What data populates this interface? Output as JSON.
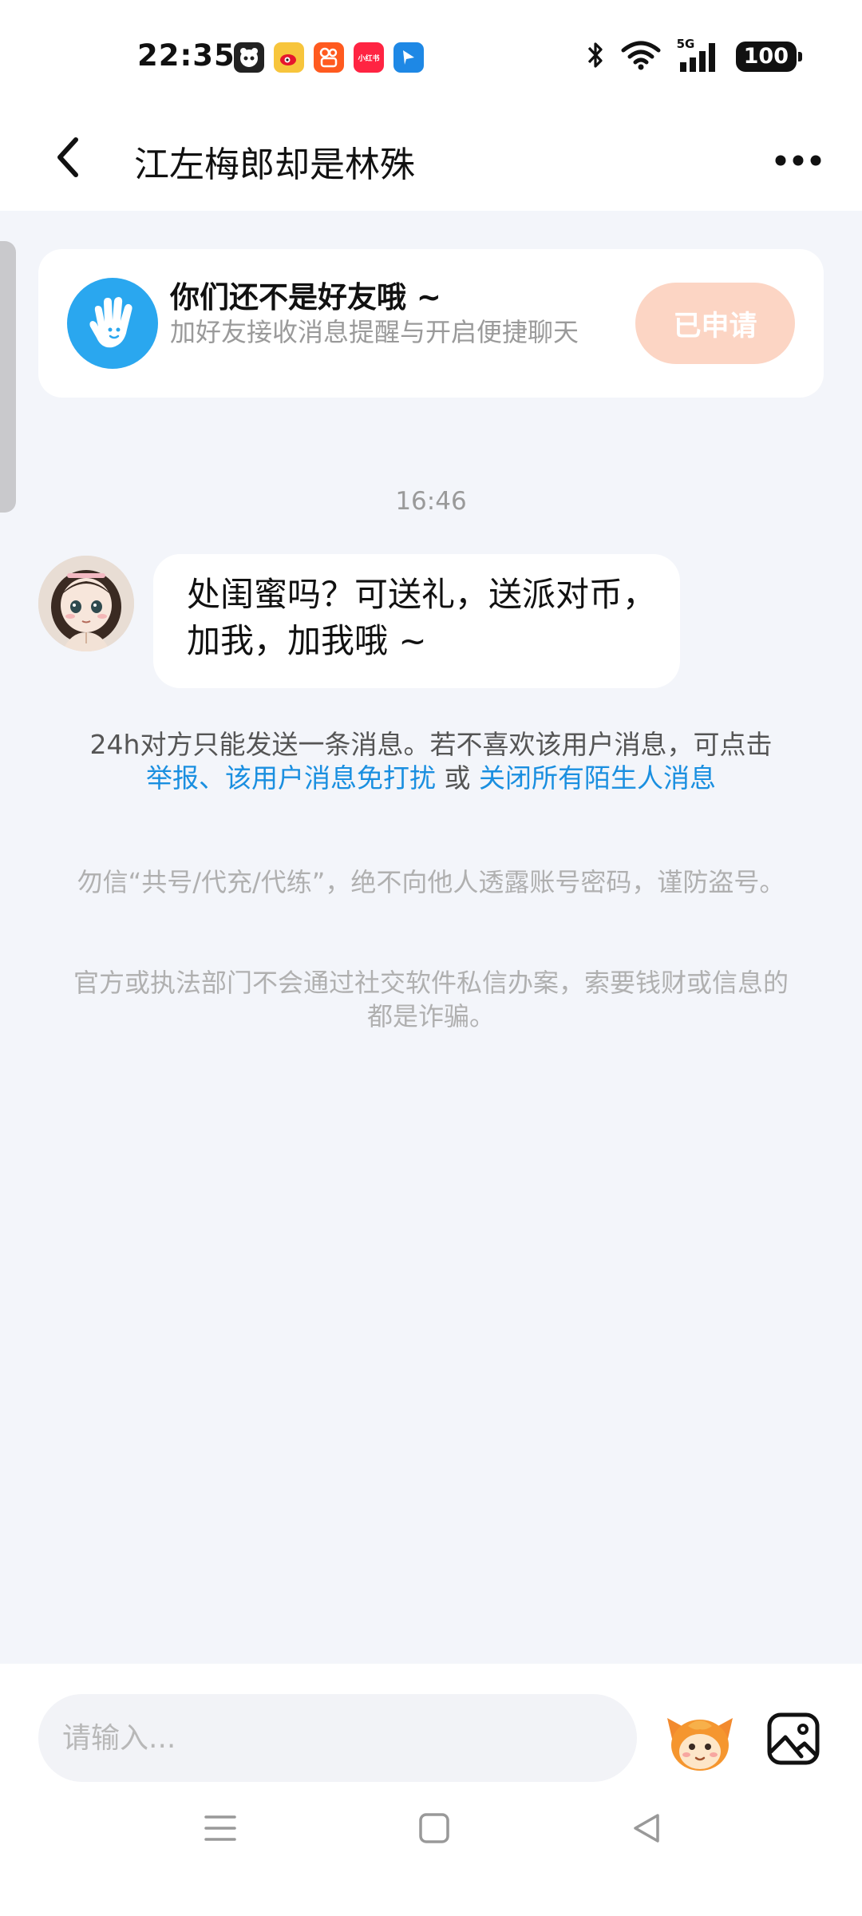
{
  "status_bar": {
    "time": "22:35",
    "network": "5G",
    "battery": "100",
    "app_icons": [
      "panda-app-icon",
      "weibo-icon",
      "kuaishou-icon",
      "xiaohongshu-icon",
      "feishu-icon"
    ],
    "xiaohongshu_label": "小红书"
  },
  "header": {
    "title": "江左梅郎却是林殊"
  },
  "friend_card": {
    "title": "你们还不是好友哦 ~",
    "subtitle": "加好友接收消息提醒与开启便捷聊天",
    "button_label": "已申请"
  },
  "chat": {
    "timestamp": "16:46",
    "message": "处闺蜜吗？可送礼，送派对币，加我，加我哦 ~"
  },
  "notice": {
    "text": "24h对方只能发送一条消息。若不喜欢该用户消息，可点击",
    "link_report": "举报",
    "link_mute": "、该用户消息免打扰",
    "or": " 或 ",
    "link_close_all": "关闭所有陌生人消息"
  },
  "warnings": {
    "warning1": "勿信“共号/代充/代练”，绝不向他人透露账号密码，谨防盗号。",
    "warning2": "官方或执法部门不会通过社交软件私信办案，索要钱财或信息的都是诈骗。"
  },
  "input_bar": {
    "placeholder": "请输入..."
  },
  "colors": {
    "accent_blue": "#1a8fe0",
    "applied_button": "#fcd5c4",
    "chat_background": "#f3f5fa"
  }
}
